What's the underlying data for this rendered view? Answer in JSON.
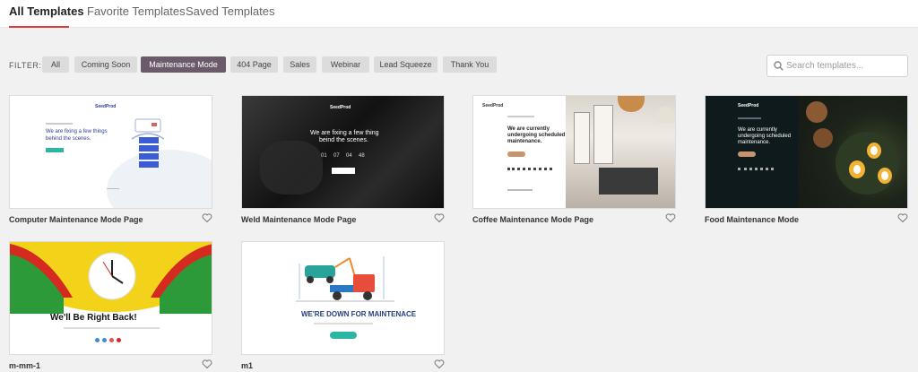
{
  "tabs": [
    {
      "label": "All Templates"
    },
    {
      "label": "Favorite Templates"
    },
    {
      "label": "Saved Templates"
    }
  ],
  "filter": {
    "label": "FILTER:",
    "options": [
      "All",
      "Coming Soon",
      "Maintenance Mode",
      "404 Page",
      "Sales",
      "Webinar",
      "Lead Squeeze",
      "Thank You"
    ],
    "active": "Maintenance Mode"
  },
  "search": {
    "placeholder": "Search templates..."
  },
  "cards": [
    {
      "title": "Computer Maintenance Mode Page",
      "thumb": {
        "brand": "SeedProd",
        "headline1": "We are fixing a few things",
        "headline2": "behind the scenes."
      }
    },
    {
      "title": "Weld Maintenance Mode Page",
      "thumb": {
        "brand": "SeedProd",
        "headline1": "We are fixing a few thing",
        "headline2": "beind the scenes.",
        "countdown": [
          "01",
          "07",
          "04",
          "48"
        ]
      }
    },
    {
      "title": "Coffee Maintenance Mode Page",
      "thumb": {
        "brand": "SeedProd",
        "headline1": "We are currently",
        "headline2": "undergoing scheduled",
        "headline3": "maintenance."
      }
    },
    {
      "title": "Food Maintenance Mode",
      "thumb": {
        "brand": "SeedProd",
        "headline1": "We are currently",
        "headline2": "undergoing scheduled",
        "headline3": "maintenance."
      }
    },
    {
      "title": "m-mm-1",
      "thumb": {
        "headline": "We'll Be Right Back!"
      }
    },
    {
      "title": "m1",
      "thumb": {
        "headline": "WE'RE DOWN FOR MAINTENACE"
      }
    }
  ],
  "colors": {
    "accent_red": "#dd3b3b",
    "active_filter": "#6b5b6a",
    "teal": "#2bb6a3"
  }
}
